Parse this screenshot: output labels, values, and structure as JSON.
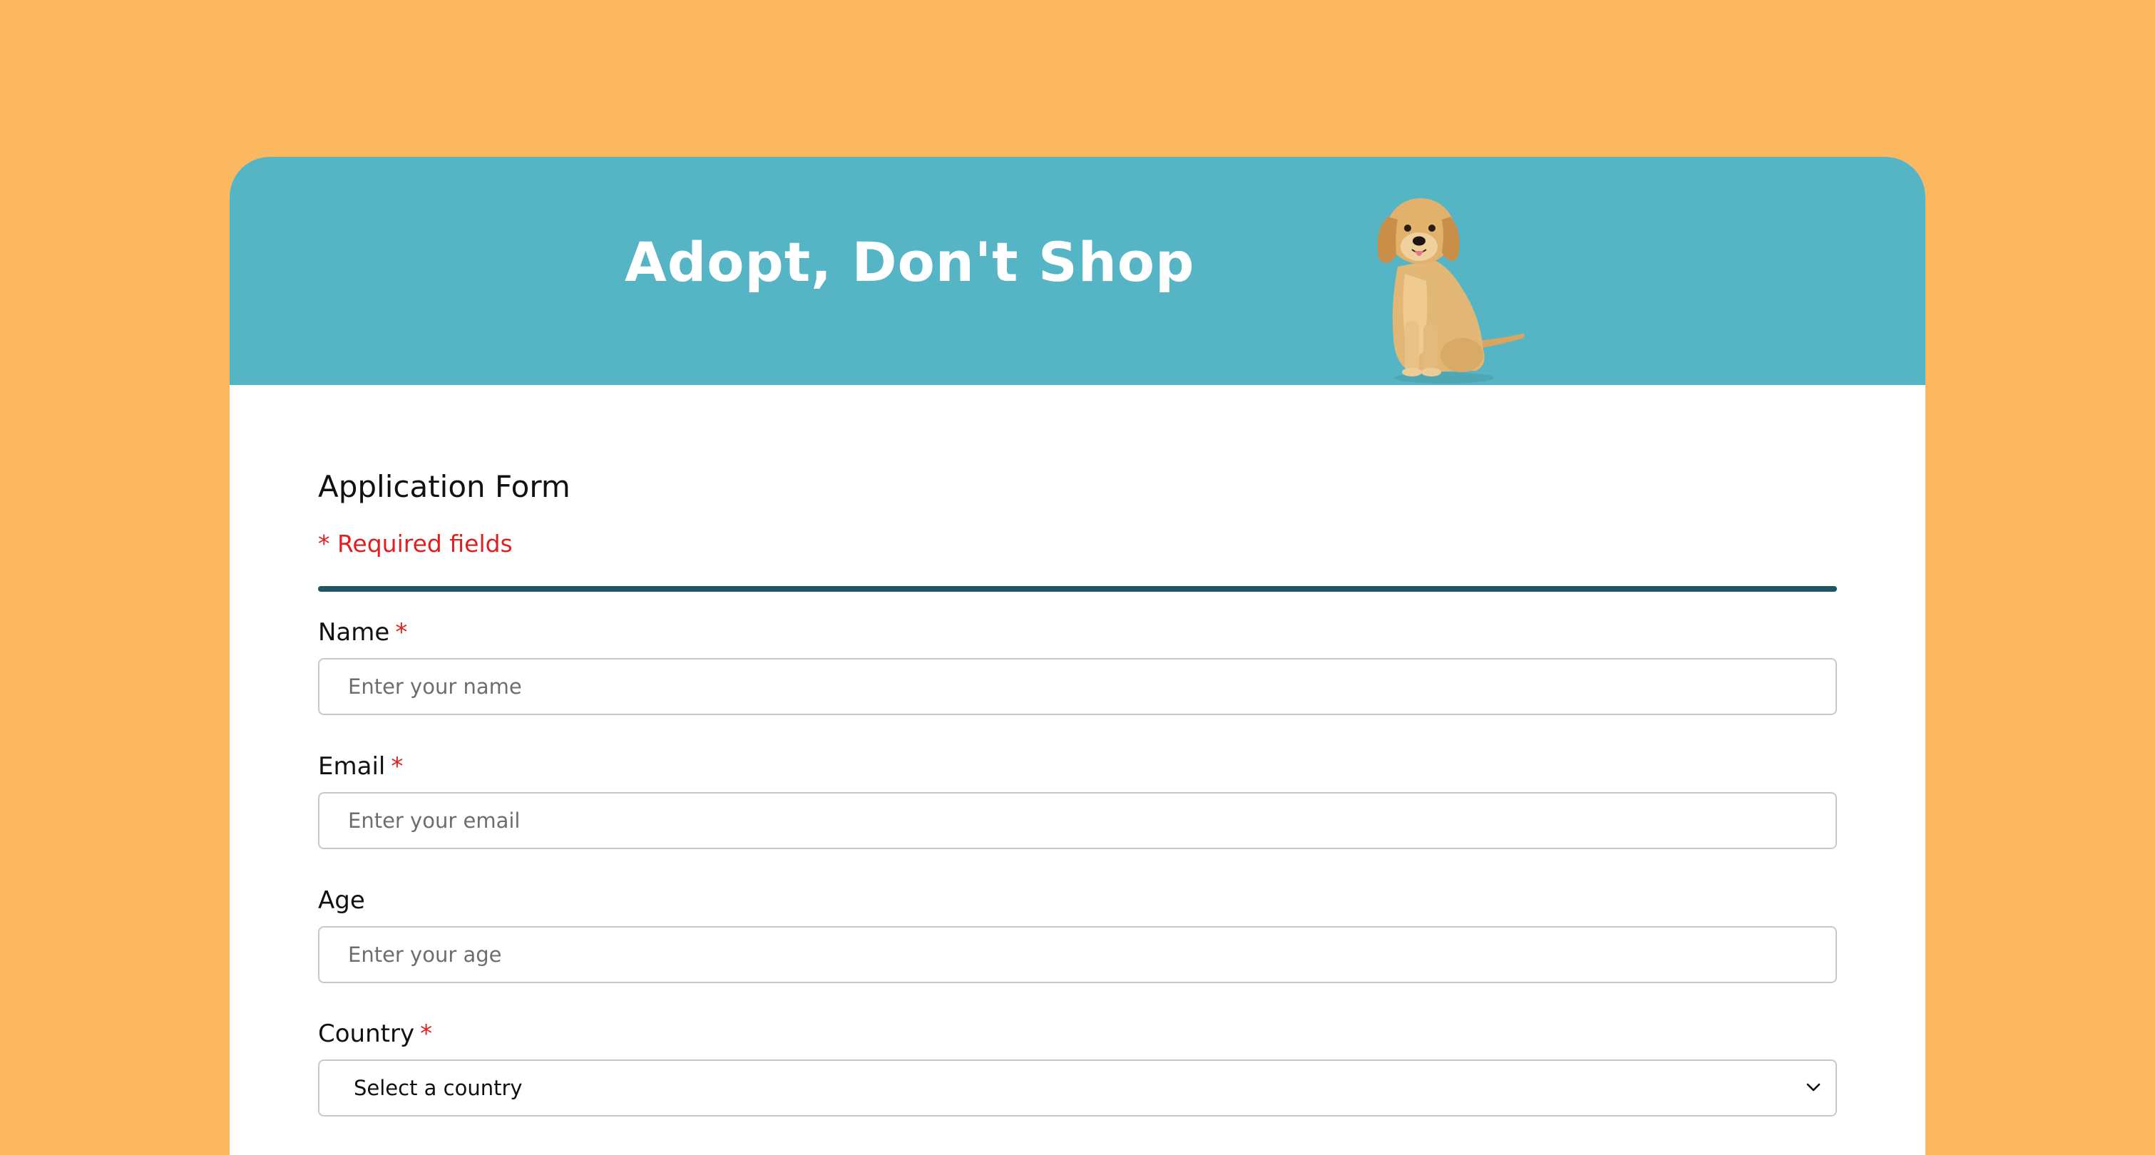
{
  "header": {
    "title": "Adopt, Don't Shop",
    "image_name": "golden-retriever-puppy"
  },
  "form": {
    "title": "Application Form",
    "required_note": "* Required fields",
    "required_marker": "*",
    "fields": {
      "name": {
        "label": "Name",
        "required": true,
        "placeholder": "Enter your name",
        "value": ""
      },
      "email": {
        "label": "Email",
        "required": true,
        "placeholder": "Enter your email",
        "value": ""
      },
      "age": {
        "label": "Age",
        "required": false,
        "placeholder": "Enter your age",
        "value": ""
      },
      "country": {
        "label": "Country",
        "required": true,
        "selected": "Select a country",
        "icon": "chevron-down-icon"
      }
    }
  },
  "colors": {
    "page_background": "#FBB860",
    "banner": "#56B5C5",
    "divider": "#1F5660",
    "required": "#E02020"
  }
}
